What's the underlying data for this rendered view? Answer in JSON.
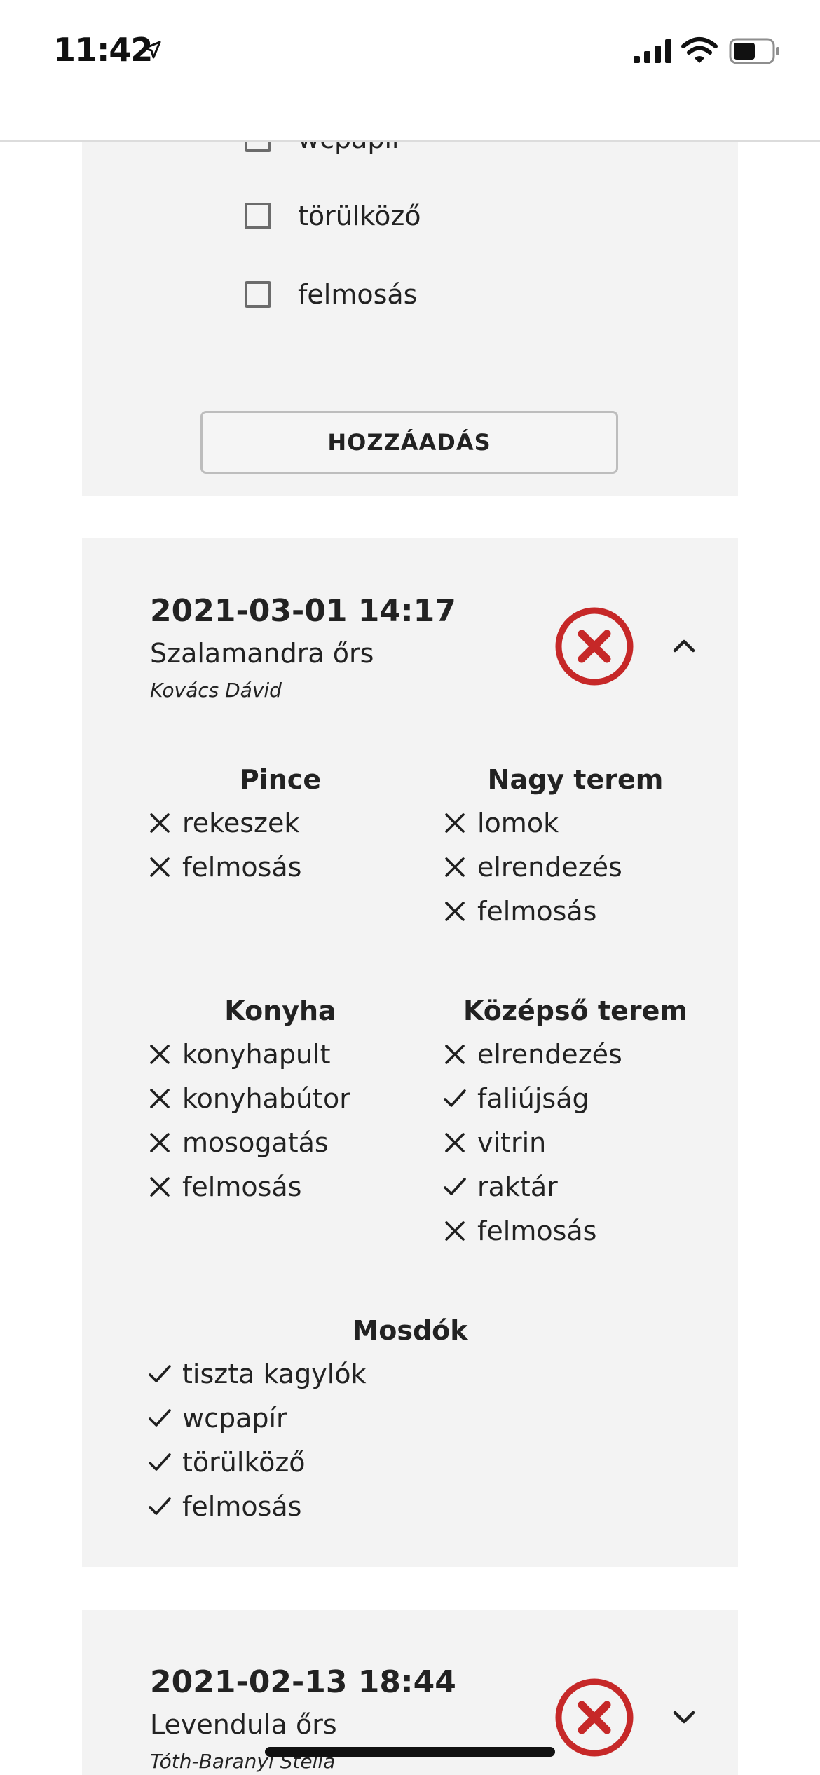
{
  "status_bar": {
    "time": "11:42"
  },
  "top_card": {
    "checklist": [
      {
        "label": "wcpapír",
        "checked": false
      },
      {
        "label": "törülköző",
        "checked": false
      },
      {
        "label": "felmosás",
        "checked": false
      }
    ],
    "add_button_label": "HOZZÁADÁS"
  },
  "entry1": {
    "datetime": "2021-03-01 14:17",
    "name": "Szalamandra őrs",
    "user": "Kovács Dávid",
    "status": "failed",
    "expanded": true,
    "sections": [
      {
        "title": "Pince",
        "items": [
          {
            "label": "rekeszek",
            "done": false
          },
          {
            "label": "felmosás",
            "done": false
          }
        ]
      },
      {
        "title": "Nagy terem",
        "items": [
          {
            "label": "lomok",
            "done": false
          },
          {
            "label": "elrendezés",
            "done": false
          },
          {
            "label": "felmosás",
            "done": false
          }
        ]
      },
      {
        "title": "Konyha",
        "items": [
          {
            "label": "konyhapult",
            "done": false
          },
          {
            "label": "konyhabútor",
            "done": false
          },
          {
            "label": "mosogatás",
            "done": false
          },
          {
            "label": "felmosás",
            "done": false
          }
        ]
      },
      {
        "title": "Középső terem",
        "items": [
          {
            "label": "elrendezés",
            "done": false
          },
          {
            "label": "faliújság",
            "done": true
          },
          {
            "label": "vitrin",
            "done": false
          },
          {
            "label": "raktár",
            "done": true
          },
          {
            "label": "felmosás",
            "done": false
          }
        ]
      },
      {
        "title": "Mosdók",
        "items": [
          {
            "label": "tiszta kagylók",
            "done": true
          },
          {
            "label": "wcpapír",
            "done": true
          },
          {
            "label": "törülköző",
            "done": true
          },
          {
            "label": "felmosás",
            "done": true
          }
        ]
      }
    ]
  },
  "entry2": {
    "datetime": "2021-02-13 18:44",
    "name": "Levendula őrs",
    "user": "Tóth-Baranyi Stella",
    "status": "failed",
    "expanded": false
  },
  "colors": {
    "fail_red": "#c62828",
    "card_bg": "#f3f3f3",
    "text": "#222222"
  }
}
